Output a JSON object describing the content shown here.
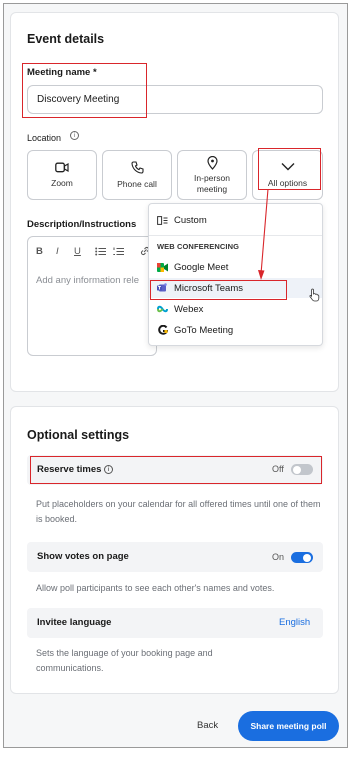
{
  "event_details": {
    "heading": "Event details",
    "meeting_name_label": "Meeting name *",
    "meeting_name_value": "Discovery Meeting",
    "location_label": "Location",
    "location_options": [
      {
        "label": "Zoom",
        "icon": "video-camera-icon"
      },
      {
        "label": "Phone call",
        "icon": "phone-icon"
      },
      {
        "label": "In-person meeting",
        "icon": "location-pin-icon"
      },
      {
        "label": "All options",
        "icon": "chevron-down-icon"
      }
    ],
    "description_label": "Description/Instructions",
    "description_placeholder": "Add any information rele",
    "toolbar": {
      "bold": "B",
      "italic": "I",
      "underline": "U"
    }
  },
  "location_dropdown": {
    "custom": "Custom",
    "heading": "WEB CONFERENCING",
    "items": [
      "Google Meet",
      "Microsoft Teams",
      "Webex",
      "GoTo Meeting"
    ],
    "highlighted": "Microsoft Teams"
  },
  "optional_settings": {
    "heading": "Optional settings",
    "reserve_times": {
      "label": "Reserve times",
      "state": "Off",
      "description": "Put placeholders on your calendar for all offered times until one of them is booked."
    },
    "show_votes": {
      "label": "Show votes on page",
      "state": "On",
      "description": "Allow poll participants to see each other's names and votes."
    },
    "invitee_language": {
      "label": "Invitee language",
      "value": "English",
      "description": "Sets the language of your booking page and communications."
    }
  },
  "footer": {
    "back": "Back",
    "share": "Share meeting poll"
  },
  "colors": {
    "accent": "#1a6ee0",
    "annotation_red": "#d9262b",
    "primary_button": "#1a6ee0"
  }
}
